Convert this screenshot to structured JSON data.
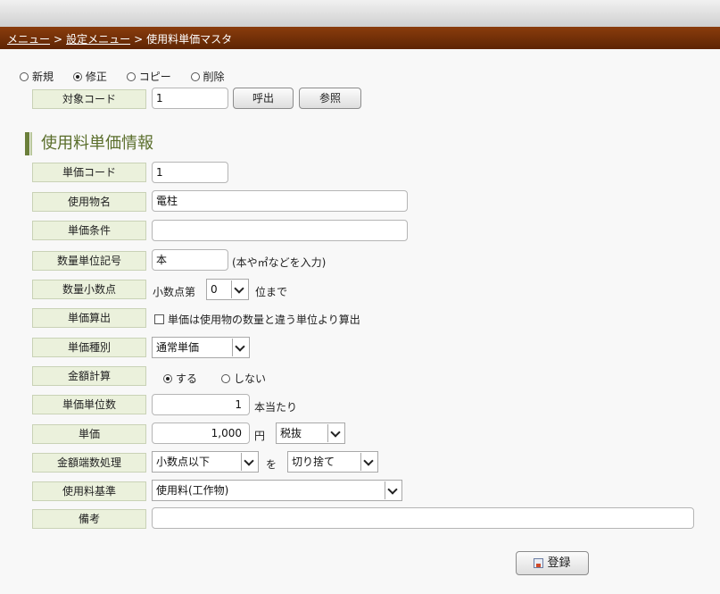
{
  "breadcrumb": {
    "menu": "メニュー",
    "settings_menu": "設定メニュー",
    "current": "使用料単価マスタ",
    "sep": ">"
  },
  "mode": {
    "options": [
      "新規",
      "修正",
      "コピー",
      "削除"
    ],
    "selected": "修正"
  },
  "target": {
    "label": "対象コード",
    "value": "1",
    "call_button": "呼出",
    "ref_button": "参照"
  },
  "section_title": "使用料単価情報",
  "form": {
    "unit_code": {
      "label": "単価コード",
      "value": "1"
    },
    "item_name": {
      "label": "使用物名",
      "value": "電柱"
    },
    "unit_condition": {
      "label": "単価条件",
      "value": ""
    },
    "qty_unit_symbol": {
      "label": "数量単位記号",
      "value": "本",
      "hint": "(本や㎡などを入力)"
    },
    "qty_decimal": {
      "label": "数量小数点",
      "prefix": "小数点第",
      "value": "0",
      "suffix": "位まで"
    },
    "unit_calc": {
      "label": "単価算出",
      "checkbox_text": "単価は使用物の数量と違う単位より算出",
      "checked": false
    },
    "unit_type": {
      "label": "単価種別",
      "value": "通常単価"
    },
    "amount_calc": {
      "label": "金額計算",
      "options": [
        "する",
        "しない"
      ],
      "selected": "する"
    },
    "unit_qty": {
      "label": "単価単位数",
      "value": "1",
      "suffix": "本当たり"
    },
    "unit_price": {
      "label": "単価",
      "value": "1,000",
      "currency": "円",
      "tax": "税抜"
    },
    "rounding": {
      "label": "金額端数処理",
      "target": "小数点以下",
      "wo": "を",
      "method": "切り捨て"
    },
    "fee_standard": {
      "label": "使用料基準",
      "value": "使用料(工作物)"
    },
    "remarks": {
      "label": "備考",
      "value": ""
    }
  },
  "save_button": "登録"
}
